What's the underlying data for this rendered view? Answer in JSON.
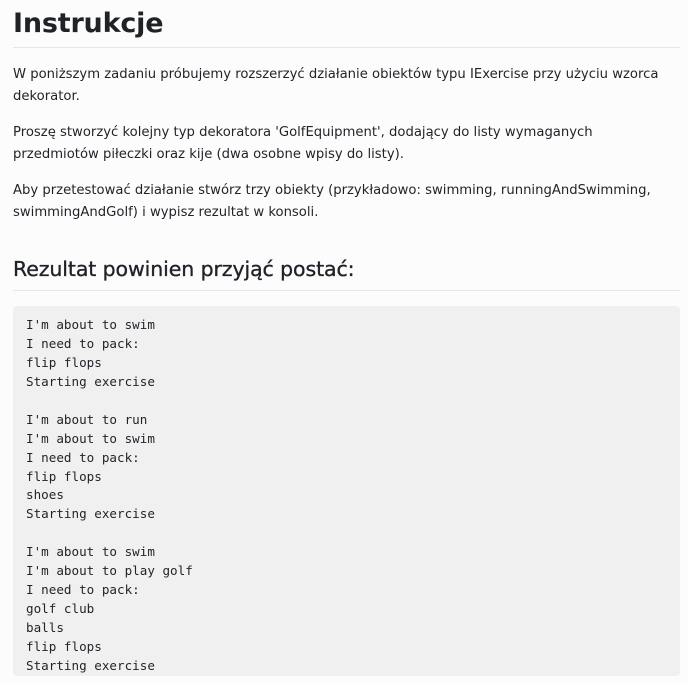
{
  "title": "Instrukcje",
  "paragraphs": [
    "W poniższym zadaniu próbujemy rozszerzyć działanie obiektów typu IExercise przy użyciu wzorca dekorator.",
    "Proszę stworzyć kolejny typ dekoratora 'GolfEquipment', dodający do listy wymaganych przedmiotów piłeczki oraz kije (dwa osobne wpisy do listy).",
    "Aby przetestować działanie stwórz trzy obiekty (przykładowo: swimming, runningAndSwimming, swimmingAndGolf) i wypisz rezultat w konsoli."
  ],
  "result_heading": "Rezultat powinien przyjąć postać:",
  "code_lines": [
    "I'm about to swim",
    "I need to pack:",
    "flip flops",
    "Starting exercise",
    "",
    "I'm about to run",
    "I'm about to swim",
    "I need to pack:",
    "flip flops",
    "shoes",
    "Starting exercise",
    "",
    "I'm about to swim",
    "I'm about to play golf",
    "I need to pack:",
    "golf club",
    "balls",
    "flip flops",
    "Starting exercise"
  ]
}
